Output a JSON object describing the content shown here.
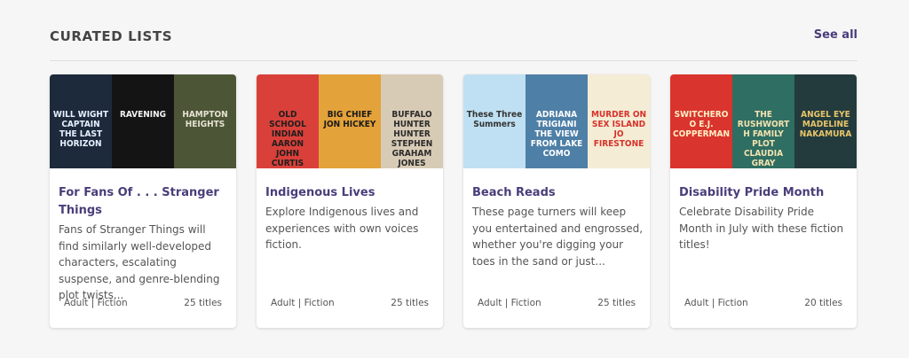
{
  "section": {
    "title": "CURATED LISTS",
    "see_all": "See all"
  },
  "colors": {
    "accent": "#4a3d7a",
    "background": "#f6f6f6"
  },
  "lists": [
    {
      "title": "For Fans Of . . . Stranger Things",
      "description": "Fans of Stranger Things will find similarly well-developed characters, escalating suspense, and genre-blending plot twists...",
      "meta": "Adult | Fiction",
      "count": "25 titles",
      "covers": [
        {
          "text": "WILL WIGHT CAPTAIN THE LAST HORIZON",
          "bg": "#1d2a3c",
          "fg": "#e7f1ff"
        },
        {
          "text": "RAVENING",
          "bg": "#141414",
          "fg": "#f2f2f2"
        },
        {
          "text": "HAMPTON HEIGHTS",
          "bg": "#4c5636",
          "fg": "#e6e2d3"
        }
      ]
    },
    {
      "title": "Indigenous Lives",
      "description": "Explore Indigenous lives and experiences with own voices fiction.",
      "meta": "Adult | Fiction",
      "count": "25 titles",
      "covers": [
        {
          "text": "OLD SCHOOL INDIAN AARON JOHN CURTIS",
          "bg": "#d9403a",
          "fg": "#1e1e1e"
        },
        {
          "text": "BIG CHIEF JON HICKEY",
          "bg": "#e4a23a",
          "fg": "#1a1a1a"
        },
        {
          "text": "BUFFALO HUNTER HUNTER STEPHEN GRAHAM JONES",
          "bg": "#d8cbb5",
          "fg": "#2b2b2b"
        }
      ]
    },
    {
      "title": "Beach Reads",
      "description": "These page turners will keep you entertained and engrossed, whether you're digging your toes in the sand or just...",
      "meta": "Adult | Fiction",
      "count": "25 titles",
      "covers": [
        {
          "text": "These Three Summers",
          "bg": "#bfe0f2",
          "fg": "#333333"
        },
        {
          "text": "ADRIANA TRIGIANI THE VIEW FROM LAKE COMO",
          "bg": "#4e7fa7",
          "fg": "#ffffff"
        },
        {
          "text": "MURDER ON SEX ISLAND JO FIRESTONE",
          "bg": "#f4ecd5",
          "fg": "#d8322b"
        }
      ]
    },
    {
      "title": "Disability Pride Month",
      "description": "Celebrate Disability Pride Month in July with these fiction titles!",
      "meta": "Adult | Fiction",
      "count": "20 titles",
      "covers": [
        {
          "text": "SWITCHEROO E.J. COPPERMAN",
          "bg": "#d9342e",
          "fg": "#fff0c6"
        },
        {
          "text": "THE RUSHWORTH FAMILY PLOT CLAUDIA GRAY",
          "bg": "#2f6e62",
          "fg": "#f3e3b0"
        },
        {
          "text": "ANGEL EYE MADELINE NAKAMURA",
          "bg": "#233b3c",
          "fg": "#e8c46a"
        }
      ]
    }
  ]
}
